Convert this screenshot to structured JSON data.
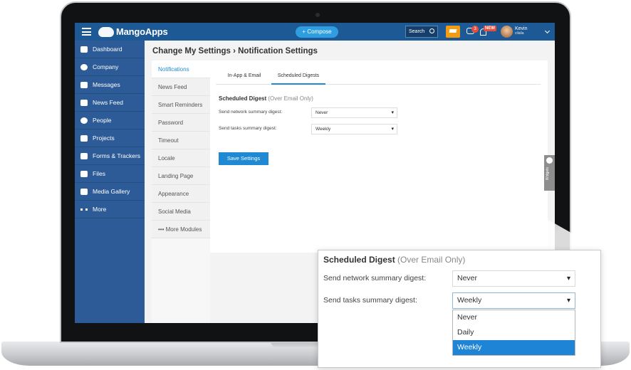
{
  "app": {
    "brand": "MangoApps",
    "compose_label": "Compose",
    "search_label": "Search",
    "chat_badge": "3",
    "notif_badge": "NEW",
    "user_name": "Kevin",
    "user_sub": "cilalia"
  },
  "sidebar": {
    "items": [
      {
        "label": "Dashboard",
        "icon": "home-icon"
      },
      {
        "label": "Company",
        "icon": "globe-icon"
      },
      {
        "label": "Messages",
        "icon": "envelope-icon"
      },
      {
        "label": "News Feed",
        "icon": "inbox-icon"
      },
      {
        "label": "People",
        "icon": "person-icon"
      },
      {
        "label": "Projects",
        "icon": "briefcase-icon"
      },
      {
        "label": "Forms & Trackers",
        "icon": "table-icon"
      },
      {
        "label": "Files",
        "icon": "file-icon"
      },
      {
        "label": "Media Gallery",
        "icon": "video-icon"
      },
      {
        "label": "More",
        "icon": "more-icon"
      }
    ]
  },
  "page": {
    "title": "Change My Settings › Notification Settings"
  },
  "submenu": {
    "items": [
      "Notifications",
      "News Feed",
      "Smart Reminders",
      "Password",
      "Timeout",
      "Locale",
      "Landing Page",
      "Appearance",
      "Social Media",
      "••• More Modules"
    ],
    "active": "Notifications"
  },
  "tabs": [
    {
      "label": "In-App & Email"
    },
    {
      "label": "Scheduled Digests"
    }
  ],
  "digest": {
    "title": "Scheduled Digest",
    "subtitle": "(Over Email Only)",
    "network_label": "Send network summary digest:",
    "network_value": "Never",
    "tasks_label": "Send tasks summary digest:",
    "tasks_value": "Weekly",
    "save_label": "Save Settings"
  },
  "widgets_tab": "Widgets",
  "callout": {
    "title": "Scheduled Digest",
    "subtitle": "(Over Email Only)",
    "network_label": "Send network summary digest:",
    "network_value": "Never",
    "tasks_label": "Send tasks summary digest:",
    "tasks_value": "Weekly",
    "options": [
      "Never",
      "Daily",
      "Weekly"
    ],
    "selected_option": "Weekly"
  },
  "colors": {
    "topbar": "#1d5a95",
    "sidebar": "#2c5b97",
    "accent": "#1f8ad3",
    "selected_option": "#1e84d6"
  }
}
